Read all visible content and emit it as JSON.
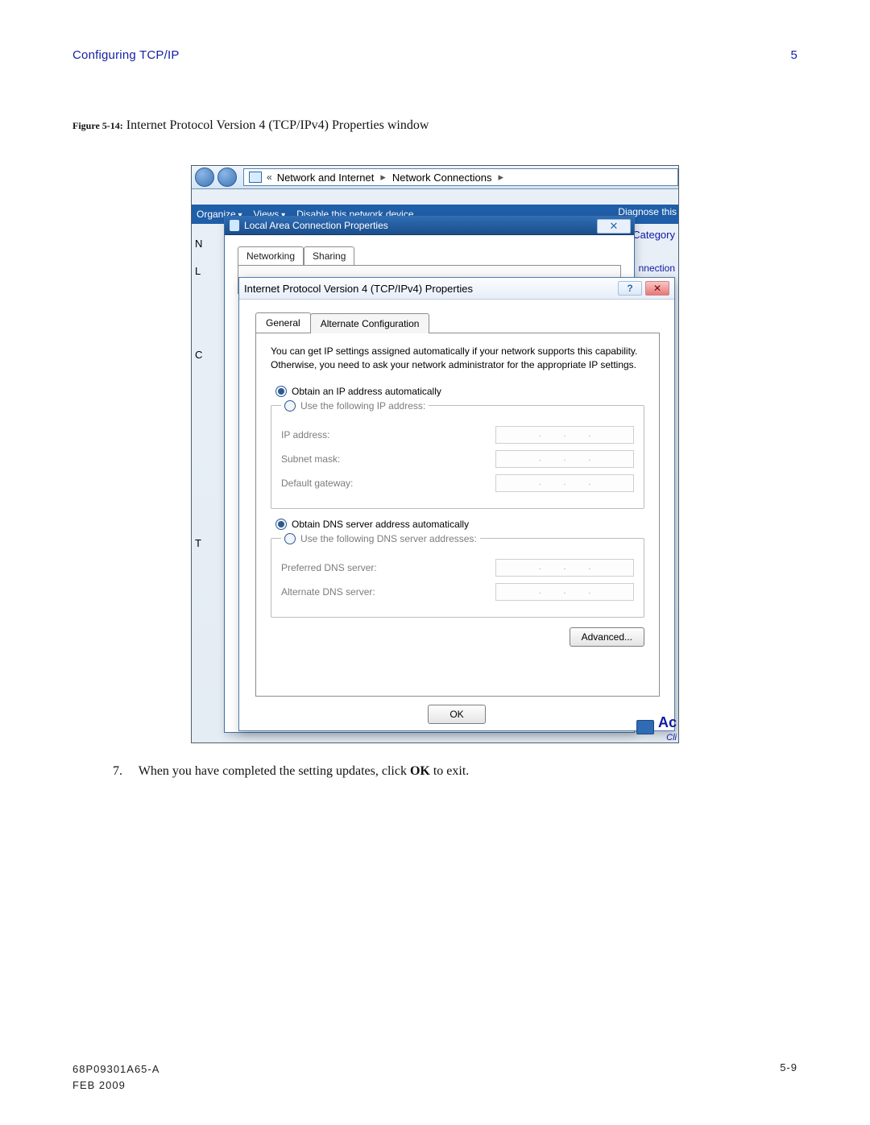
{
  "page": {
    "section_title": "Configuring TCP/IP",
    "section_number": "5",
    "figure_label": "Figure 5-14:",
    "figure_caption": "Internet Protocol Version 4 (TCP/IPv4) Properties window",
    "step_number": "7.",
    "step_text_before": "When you have completed the setting updates, click ",
    "step_bold": "OK",
    "step_text_after": " to exit.",
    "doc_id": "68P09301A65-A",
    "doc_date": "FEB 2009",
    "page_number": "5-9"
  },
  "explorer": {
    "breadcrumb": {
      "chevrons": "«",
      "item1": "Network and Internet",
      "item2": "Network Connections",
      "sep": "▸"
    },
    "toolbar": {
      "organize": "Organize",
      "views": "Views",
      "disable": "Disable this network device",
      "diagnose": "Diagnose this"
    },
    "side_category": "rk Category",
    "side_nection": "nnection",
    "side_letters": {
      "n": "N",
      "l": "L",
      "c": "C",
      "t": "T"
    },
    "corner_ac": "Ac",
    "corner_cli": "Cli"
  },
  "lac": {
    "title": "Local Area Connection Properties",
    "close": "✕",
    "tabs": {
      "networking": "Networking",
      "sharing": "Sharing"
    }
  },
  "ipv4": {
    "title": "Internet Protocol Version 4 (TCP/IPv4) Properties",
    "help": "?",
    "close": "✕",
    "tabs": {
      "general": "General",
      "alternate": "Alternate Configuration"
    },
    "blurb": "You can get IP settings assigned automatically if your network supports this capability. Otherwise, you need to ask your network administrator for the appropriate IP settings.",
    "ip_group": {
      "auto": "Obtain an IP address automatically",
      "manual": "Use the following IP address:",
      "fields": {
        "ip": "IP address:",
        "subnet": "Subnet mask:",
        "gateway": "Default gateway:"
      }
    },
    "dns_group": {
      "auto": "Obtain DNS server address automatically",
      "manual": "Use the following DNS server addresses:",
      "fields": {
        "pref": "Preferred DNS server:",
        "alt": "Alternate DNS server:"
      }
    },
    "advanced": "Advanced...",
    "ok": "OK"
  }
}
